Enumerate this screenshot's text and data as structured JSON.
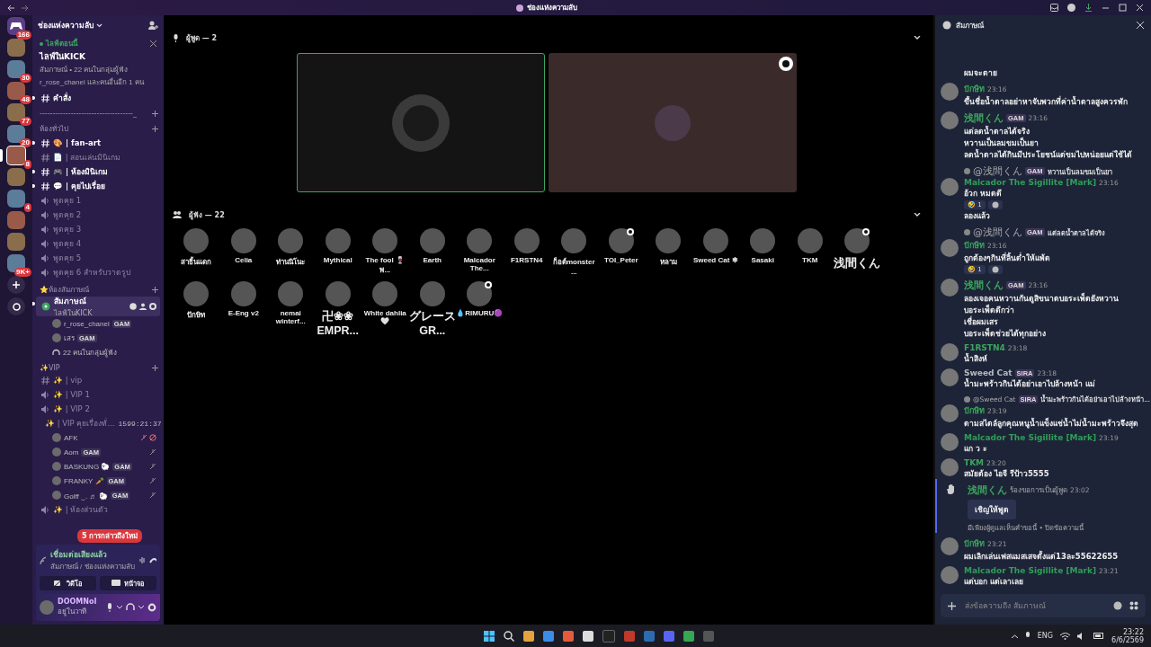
{
  "title_bar": {
    "title": "ช่องแห่งความลับ"
  },
  "servers": [
    {
      "kind": "home",
      "badge": "166",
      "selected": false
    },
    {
      "kind": "guild",
      "selected": false
    },
    {
      "kind": "guild",
      "badge": "30",
      "selected": false
    },
    {
      "kind": "guild",
      "badge": "48",
      "selected": false
    },
    {
      "kind": "guild",
      "badge": "77",
      "selected": false
    },
    {
      "kind": "guild",
      "badge": "20",
      "selected": false
    },
    {
      "kind": "guild",
      "badge": "8",
      "selected": true
    },
    {
      "kind": "guild",
      "selected": false
    },
    {
      "kind": "guild",
      "badge": "4",
      "selected": false
    },
    {
      "kind": "guild",
      "selected": false
    },
    {
      "kind": "guild",
      "selected": false
    },
    {
      "kind": "guild",
      "badge": "9K+",
      "selected": false
    },
    {
      "kind": "add",
      "selected": false
    },
    {
      "kind": "discover",
      "selected": false
    }
  ],
  "sidebar": {
    "server_name": "ช่องแห่งความลับ",
    "event": {
      "status": "ไลฟ์ตอนนี้",
      "title": "ไลฟ์ในKICK",
      "host_line": "สัมภาษณ์ • 22 คนในกลุ่มผู้ฟัง",
      "attendees": "r_rose_chanel และคนอื่นอีก 1 คน"
    },
    "categories": [
      {
        "channels": [
          {
            "kind": "text",
            "name": "คำสั่ง",
            "unread": true,
            "selected": false
          }
        ]
      },
      {
        "name": "------------------------------------_"
      },
      {
        "name": "ห้องทั่วไป",
        "channels": [
          {
            "kind": "text",
            "name": "🎨 | fan-art",
            "unread": true,
            "selected": false
          },
          {
            "kind": "text",
            "name": "📄 | สอนเล่นมินิเกม",
            "unread": false,
            "selected": false
          },
          {
            "kind": "text",
            "name": "🎮 | ห้องมินิเกม",
            "unread": true,
            "selected": false
          },
          {
            "kind": "text",
            "name": "💬 | คุยไปเรื่อย",
            "unread": true,
            "selected": false
          },
          {
            "kind": "voice",
            "name": "พูดคุย 1",
            "unread": false,
            "selected": false
          },
          {
            "kind": "voice",
            "name": "พูดคุย 2",
            "unread": false,
            "selected": false
          },
          {
            "kind": "voice",
            "name": "พูดคุย 3",
            "unread": false,
            "selected": false
          },
          {
            "kind": "voice",
            "name": "พูดคุย 4",
            "unread": false,
            "selected": false
          },
          {
            "kind": "voice",
            "name": "พูดคุย 5",
            "unread": false,
            "selected": false
          },
          {
            "kind": "voice",
            "name": "พูดคุย 6 สำหรับวาดรูป",
            "unread": false,
            "selected": false
          }
        ]
      },
      {
        "name": "⭐ห้องสัมภาษณ์",
        "channels": [
          {
            "kind": "stage",
            "name": "สัมภาษณ์",
            "unread": true,
            "selected": true,
            "subtitle": "ไลฟ์ในKICK",
            "members": [
              {
                "name": "r_rose_chanel",
                "tag": "GAM"
              },
              {
                "name": "เสร",
                "tag": "GAM"
              }
            ],
            "listeners": "22 คนในกลุ่มผู้ฟัง"
          }
        ]
      },
      {
        "name": "✨VIP",
        "channels": [
          {
            "kind": "text",
            "name": "✨ | vip",
            "unread": false,
            "selected": false
          },
          {
            "kind": "voice",
            "name": "✨ | VIP 1",
            "unread": false,
            "selected": false
          },
          {
            "kind": "voice",
            "name": "✨ | VIP 2",
            "unread": false,
            "selected": false
          },
          {
            "kind": "voice",
            "name": "✨ | VIP คุยเรื่องทั่...",
            "unread": false,
            "selected": false,
            "timer": "1599:21:37",
            "members": [
              {
                "name": "AFK",
                "muted": true,
                "deafened": true
              },
              {
                "name": "Aom",
                "tag": "GAM",
                "muted": true,
                "deafened": false
              },
              {
                "name": "BASKUNG 🐑",
                "tag": "GAM",
                "muted": true,
                "deafened": false
              },
              {
                "name": "FRANKY 🥕",
                "tag": "GAM",
                "muted": true,
                "deafened": false
              },
              {
                "name": "Golff ‿. ♬ 🐑",
                "tag": "GAM",
                "muted": true,
                "deafened": false
              }
            ]
          },
          {
            "kind": "voice",
            "name": "✨ | ห้องส่วนตัว",
            "unread": false,
            "selected": false
          }
        ]
      }
    ],
    "mentions": "5 การกล่าวถึงใหม่",
    "voice_panel": {
      "status": "เชื่อมต่อเสียงแล้ว",
      "location": "สัมภาษณ์ / ช่องแห่งความลับ",
      "buttons": [
        "วิดีโอ",
        "หน้าจอ"
      ]
    },
    "user": {
      "name": "DOOMNoI",
      "status": "อยู่ในวาที"
    }
  },
  "stage": {
    "speakers_header": "ผู้พูด — 2",
    "speakers": [
      {
        "speaking": true,
        "moderator": false
      },
      {
        "speaking": false,
        "moderator": true
      }
    ],
    "listeners_header": "ผู้ฟัง — 22",
    "listeners": [
      {
        "name": "สาธิ้นแดก",
        "moderator": false
      },
      {
        "name": "Celia",
        "moderator": false
      },
      {
        "name": "ท่านนิโนะ",
        "moderator": false
      },
      {
        "name": "Mythical",
        "moderator": false
      },
      {
        "name": "The fool 🍷 พ...",
        "moderator": false
      },
      {
        "name": "Earth",
        "moderator": false
      },
      {
        "name": "Malcador The...",
        "moderator": false
      },
      {
        "name": "F1RSTN4",
        "moderator": false
      },
      {
        "name": "ก็อต์monster ...",
        "moderator": false
      },
      {
        "name": "TOI_Peter",
        "moderator": true
      },
      {
        "name": "หลาม",
        "moderator": false
      },
      {
        "name": "Sweed Cat ❄",
        "moderator": false
      },
      {
        "name": "Sasaki",
        "moderator": false
      },
      {
        "name": "TKM",
        "moderator": false
      },
      {
        "name": "浅間くん",
        "moderator": true
      },
      {
        "name": "ปักษิท",
        "moderator": false
      },
      {
        "name": "E-Eng v2",
        "moderator": false
      },
      {
        "name": "nemai winterf...",
        "moderator": false
      },
      {
        "name": "卍❀❀ EMPR...",
        "moderator": false
      },
      {
        "name": "White dahlia🤍",
        "moderator": false
      },
      {
        "name": "グレース GR...",
        "moderator": false
      },
      {
        "name": "💧RIMURU🟣",
        "moderator": true
      }
    ]
  },
  "chat": {
    "title": "สัมภาษณ์",
    "placeholder": "ส่งข้อความถึง สัมภาษณ์",
    "messages": [
      {
        "kind": "message",
        "lines": [
          "ผมจะตาย"
        ]
      },
      {
        "kind": "message",
        "author": "ปักษิท",
        "color": "#3ba55d",
        "time": "23:16",
        "lines": [
          "ขึ้นชื่อน้ำตาลอย่าหาจับพวกที่ค่าน้ำตาลสูงควรพัก"
        ]
      },
      {
        "kind": "message",
        "author": "浅間くん",
        "color": "#3ba55d",
        "tag": "GAM",
        "time": "23:16",
        "lines": [
          "แต่ลดน้ำตาลได้จริง",
          "หวานเป็นลมขมเป็นยา",
          "ลดน้ำตาลได้กินมีประโยชน์แต่ขมไปหน่อยแต่ใช้ได้"
        ]
      },
      {
        "kind": "message",
        "reply": {
          "author": "@浅間くん",
          "tag": "GAM",
          "text": "หวานเป็นลมขมเป็นยา"
        },
        "author": "Malcador The Sigillite [Mark]",
        "color": "#2f9e58",
        "time": "23:16",
        "lines": [
          "อ้วก หมดดี"
        ],
        "reactions": [
          {
            "emoji": "🤣",
            "count": "1"
          }
        ]
      },
      {
        "kind": "message",
        "lines": [
          "ลองแล้ว"
        ]
      },
      {
        "kind": "message",
        "reply": {
          "author": "@浅間くん",
          "tag": "GAM",
          "text": "แต่ลดน้ำตาลได้จริง"
        },
        "author": "ปักษิท",
        "color": "#3ba55d",
        "time": "23:16",
        "lines": [
          "ถูกต้องๆกินที่ลิ้นต่ำให้แพ้ด"
        ],
        "reactions": [
          {
            "emoji": "🤣",
            "count": "1"
          }
        ]
      },
      {
        "kind": "message",
        "author": "浅間くん",
        "color": "#3ba55d",
        "tag": "GAM",
        "time": "23:16",
        "lines": [
          "ลองเจอคนหวานกันดูสิขนาดบอระเพ็ดยังหวาน",
          "บอระเพ็ดดีกว่า",
          "เชื่อผมเสร",
          "บอระเพ็ดช่วยได้ทุกอย่าง"
        ]
      },
      {
        "kind": "message",
        "author": "F1RSTN4",
        "color": "#3ba55d",
        "time": "23:18",
        "lines": [
          "น้ำสิงห์"
        ]
      },
      {
        "kind": "message",
        "author": "Sweed Cat",
        "color": "#b5bac1",
        "tag": "SIRA",
        "time": "23:18",
        "lines": [
          "น้ำมะพร้าวกินได้อย่าเอาไปล้างหน้า แม่"
        ]
      },
      {
        "kind": "message",
        "reply": {
          "author": "@Sweed Cat",
          "tag": "SIRA",
          "text": "น้ำมะพร้าวกินได้อย่าเอาไปล้างหน้า..."
        },
        "author": "ปักษิท",
        "color": "#3ba55d",
        "time": "23:19",
        "lines": [
          "ตามสไตล์ลูกคุณหนูน้ำแข็งแช่น้ำไม่น้ำมะพร้าวจึงสุด"
        ]
      },
      {
        "kind": "message",
        "author": "Malcador The Sigillite [Mark]",
        "color": "#2f9e58",
        "time": "23:19",
        "lines": [
          "แก ว ะ"
        ]
      },
      {
        "kind": "message",
        "author": "TKM",
        "color": "#3ba55d",
        "time": "23:20",
        "lines": [
          "สมัยต้อง ไอจี รีป้าว5555"
        ]
      },
      {
        "kind": "request",
        "author": "浅間くん",
        "color": "#3ba55d",
        "text": "ร้องขอการเป็นผู้พูด",
        "time": "23:02",
        "button": "เชิญให้พูด",
        "note": "มีเพียงผู้ดูแลเห็นคำขอนี้ • ปิดข้อความนี้"
      },
      {
        "kind": "message",
        "author": "ปักษิท",
        "color": "#3ba55d",
        "time": "23:21",
        "lines": [
          "ผมเลิกเล่นเฟสแมสเสจตั้งแต่13ละ55622655"
        ]
      },
      {
        "kind": "message",
        "author": "Malcador The Sigillite [Mark]",
        "color": "#2f9e58",
        "time": "23:21",
        "lines": [
          "แต่บอก แต่เลาเลย"
        ]
      }
    ]
  },
  "taskbar": {
    "language": "ENG",
    "time": "23:22",
    "date": "6/6/2569"
  }
}
